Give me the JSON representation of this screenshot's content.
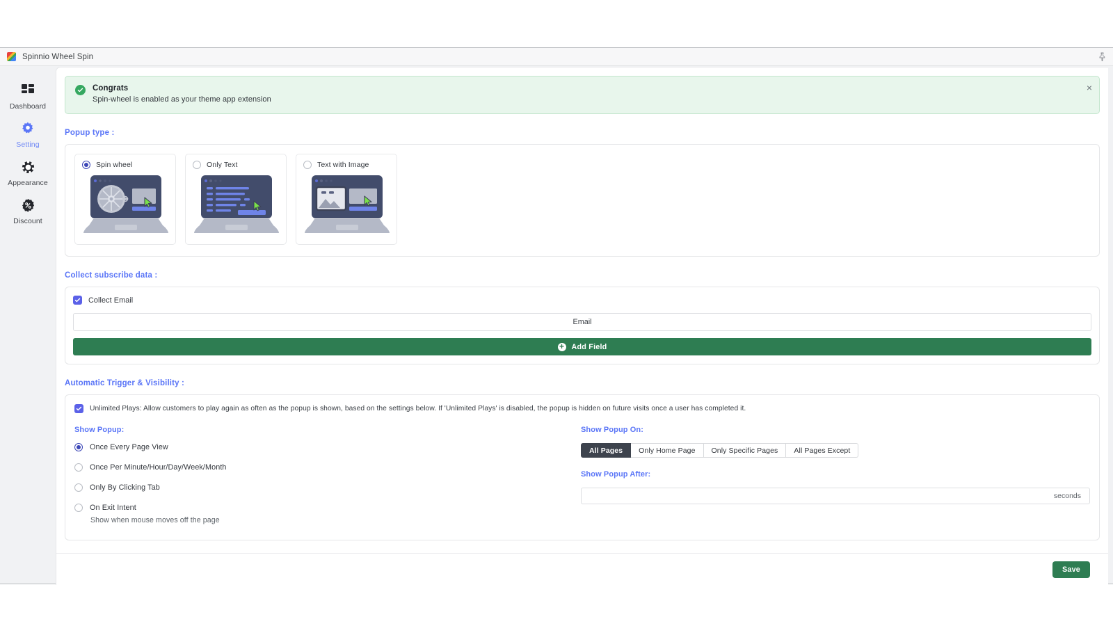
{
  "titlebar": {
    "app_title": "Spinnio Wheel Spin",
    "pin_icon": "pin-icon"
  },
  "sidebar": {
    "items": [
      {
        "label": "Dashboard",
        "icon": "dashboard-grid-icon",
        "active": false
      },
      {
        "label": "Setting",
        "icon": "gear-icon",
        "active": true
      },
      {
        "label": "Appearance",
        "icon": "palette-icon",
        "active": false
      },
      {
        "label": "Discount",
        "icon": "discount-tag-icon",
        "active": false
      }
    ]
  },
  "banner": {
    "icon": "check-circle-icon",
    "title": "Congrats",
    "subtitle": "Spin-wheel is enabled as your theme app extension",
    "close_label": "×",
    "bg_color": "#e8f6ec",
    "accent_color": "#35a860"
  },
  "popup_type": {
    "section_label": "Popup type :",
    "options": [
      {
        "label": "Spin wheel",
        "selected": true,
        "art": "laptop-spinwheel"
      },
      {
        "label": "Only Text",
        "selected": false,
        "art": "laptop-onlytext"
      },
      {
        "label": "Text with Image",
        "selected": false,
        "art": "laptop-textimage"
      }
    ]
  },
  "collect": {
    "section_label": "Collect subscribe data :",
    "collect_email_label": "Collect Email",
    "collect_email_checked": true,
    "email_field_value": "Email",
    "add_field_label": "Add Field",
    "add_field_icon": "plus-circle-icon",
    "add_field_color": "#2e7d52"
  },
  "trigger": {
    "section_label": "Automatic Trigger & Visibility :",
    "unlimited_checked": true,
    "unlimited_text": "Unlimited Plays: Allow customers to play again as often as the popup is shown, based on the settings below. If 'Unlimited Plays' is disabled, the popup is hidden on future visits once a user has completed it.",
    "show_popup_label": "Show Popup:",
    "show_popup_options": [
      {
        "label": "Once Every Page View",
        "selected": true
      },
      {
        "label": "Once Per Minute/Hour/Day/Week/Month",
        "selected": false
      },
      {
        "label": "Only By Clicking Tab",
        "selected": false
      },
      {
        "label": "On Exit Intent",
        "selected": false
      }
    ],
    "exit_intent_help": "Show when mouse moves off the page",
    "show_popup_on_label": "Show Popup On:",
    "show_popup_on_options": [
      {
        "label": "All Pages",
        "active": true
      },
      {
        "label": "Only Home Page",
        "active": false
      },
      {
        "label": "Only Specific Pages",
        "active": false
      },
      {
        "label": "All Pages Except",
        "active": false
      }
    ],
    "show_popup_after_label": "Show Popup After:",
    "seconds_value": "",
    "seconds_suffix": "seconds"
  },
  "footer": {
    "save_label": "Save",
    "save_color": "#2e7d52"
  }
}
